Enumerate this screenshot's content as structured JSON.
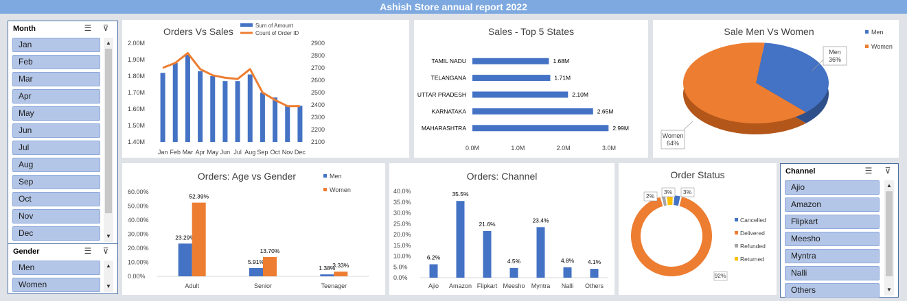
{
  "report_title": "Ashish Store annual report 2022",
  "slicers": {
    "month": {
      "title": "Month",
      "items": [
        "Jan",
        "Feb",
        "Mar",
        "Apr",
        "May",
        "Jun",
        "Jul",
        "Aug",
        "Sep",
        "Oct",
        "Nov",
        "Dec"
      ]
    },
    "gender": {
      "title": "Gender",
      "items": [
        "Men",
        "Women"
      ]
    },
    "channel": {
      "title": "Channel",
      "items": [
        "Ajio",
        "Amazon",
        "Flipkart",
        "Meesho",
        "Myntra",
        "Nalli",
        "Others"
      ]
    }
  },
  "colors": {
    "blue": "#4472c4",
    "orange": "#ed7d31",
    "gray": "#a5a5a5",
    "gold": "#ffc000"
  },
  "chart_data": [
    {
      "id": "orders_vs_sales",
      "type": "bar",
      "title": "Orders Vs Sales",
      "categories": [
        "Jan",
        "Feb",
        "Mar",
        "Apr",
        "May",
        "Jun",
        "Jul",
        "Aug",
        "Sep",
        "Oct",
        "Nov",
        "Dec"
      ],
      "series": [
        {
          "name": "Sum of Amount",
          "type": "bar",
          "axis": "left",
          "values": [
            1.82,
            1.88,
            1.93,
            1.83,
            1.8,
            1.77,
            1.77,
            1.81,
            1.7,
            1.67,
            1.62,
            1.62
          ]
        },
        {
          "name": "Count of Order ID",
          "type": "line",
          "axis": "right",
          "values": [
            2700,
            2740,
            2820,
            2690,
            2640,
            2620,
            2610,
            2690,
            2500,
            2440,
            2390,
            2390
          ]
        }
      ],
      "ylim_left": [
        1.4,
        2.0
      ],
      "ylim_right": [
        2100,
        2900
      ],
      "yticks_left": [
        "1.40M",
        "1.50M",
        "1.60M",
        "1.70M",
        "1.80M",
        "1.90M",
        "2.00M"
      ],
      "yticks_right": [
        "2100",
        "2200",
        "2300",
        "2400",
        "2500",
        "2600",
        "2700",
        "2800",
        "2900"
      ]
    },
    {
      "id": "top5_states",
      "type": "bar",
      "orientation": "horizontal",
      "title": "Sales - Top 5 States",
      "categories": [
        "TAMIL NADU",
        "TELANGANA",
        "UTTAR PRADESH",
        "KARNATAKA",
        "MAHARASHTRA"
      ],
      "values": [
        1.68,
        1.71,
        2.1,
        2.65,
        2.99
      ],
      "labels": [
        "1.68M",
        "1.71M",
        "2.10M",
        "2.65M",
        "2.99M"
      ],
      "xlim": [
        0,
        3.0
      ],
      "xticks": [
        "0.0M",
        "1.0M",
        "2.0M",
        "3.0M"
      ]
    },
    {
      "id": "men_vs_women",
      "type": "pie",
      "title": "Sale Men Vs Women",
      "categories": [
        "Men",
        "Women"
      ],
      "values": [
        36,
        64
      ],
      "labels": [
        "36%",
        "64%"
      ],
      "legend": "top-right"
    },
    {
      "id": "age_vs_gender",
      "type": "bar",
      "title": "Orders: Age vs Gender",
      "categories": [
        "Adult",
        "Senior",
        "Teenager"
      ],
      "series": [
        {
          "name": "Men",
          "values": [
            23.29,
            5.91,
            1.38
          ],
          "labels": [
            "23.29%",
            "5.91%",
            "1.38%"
          ]
        },
        {
          "name": "Women",
          "values": [
            52.39,
            13.7,
            3.33
          ],
          "labels": [
            "52.39%",
            "13.70%",
            "3.33%"
          ]
        }
      ],
      "ylim": [
        0,
        60
      ],
      "yticks": [
        "0.00%",
        "10.00%",
        "20.00%",
        "30.00%",
        "40.00%",
        "50.00%",
        "60.00%"
      ],
      "legend": "top-right"
    },
    {
      "id": "orders_channel",
      "type": "bar",
      "title": "Orders: Channel",
      "categories": [
        "Ajio",
        "Amazon",
        "Flipkart",
        "Meesho",
        "Myntra",
        "Nalli",
        "Others"
      ],
      "values": [
        6.2,
        35.5,
        21.6,
        4.5,
        23.4,
        4.8,
        4.1
      ],
      "labels": [
        "6.2%",
        "35.5%",
        "21.6%",
        "4.5%",
        "23.4%",
        "4.8%",
        "4.1%"
      ],
      "ylim": [
        0,
        40
      ],
      "yticks": [
        "0.0%",
        "5.0%",
        "10.0%",
        "15.0%",
        "20.0%",
        "25.0%",
        "30.0%",
        "35.0%",
        "40.0%"
      ]
    },
    {
      "id": "order_status",
      "type": "pie",
      "subtype": "doughnut",
      "title": "Order Status",
      "categories": [
        "Cancelled",
        "Delivered",
        "Refunded",
        "Returned"
      ],
      "values": [
        3,
        92,
        2,
        3
      ],
      "labels": [
        "3%",
        "92%",
        "2%",
        "3%"
      ],
      "legend": "right"
    }
  ]
}
